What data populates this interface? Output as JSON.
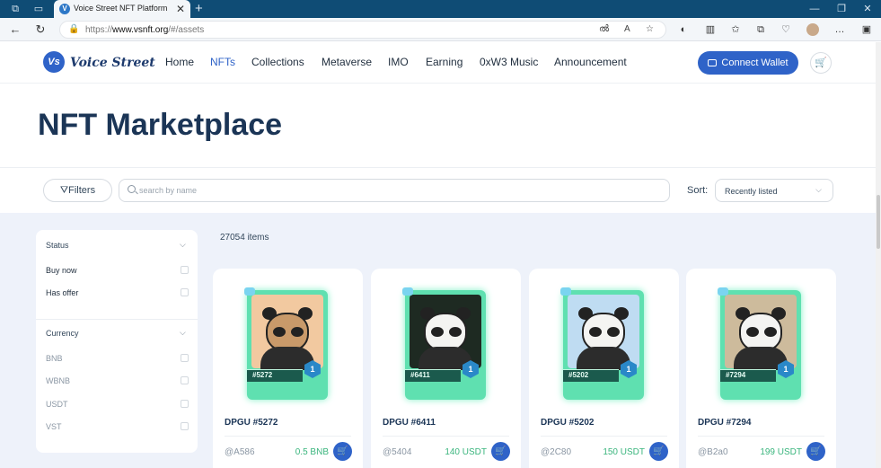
{
  "browser": {
    "tab_title": "Voice Street NFT Platform",
    "url_prefix": "https://",
    "url_host": "www.vsnft.org",
    "url_path": "/#/assets",
    "tab_close": "✕",
    "new_tab": "+"
  },
  "header": {
    "logo_mark": "Vs",
    "logo_text": "Voice Street",
    "nav": [
      "Home",
      "NFTs",
      "Collections",
      "Metaverse",
      "IMO",
      "Earning",
      "0xW3 Music",
      "Announcement"
    ],
    "active_nav": "NFTs",
    "connect_label": "Connect Wallet"
  },
  "hero": {
    "title": "NFT Marketplace"
  },
  "toolbar": {
    "filters_label": "Filters",
    "search_placeholder": "search by name",
    "search_value": "",
    "sort_label": "Sort:",
    "sort_value": "Recently listed"
  },
  "sidebar": {
    "status_title": "Status",
    "status_items": [
      "Buy now",
      "Has offer"
    ],
    "currency_title": "Currency",
    "currency_items": [
      "BNB",
      "WBNB",
      "USDT",
      "VST"
    ]
  },
  "results": {
    "count": "27054 items"
  },
  "cards": [
    {
      "title": "DPGU #5272",
      "tag": "#5272",
      "owner": "@A586",
      "price": "0.5 BNB",
      "rank": "1",
      "bg": "#f2c9a0",
      "fur": "#c99a6a"
    },
    {
      "title": "DPGU #6411",
      "tag": "#6411",
      "owner": "@5404",
      "price": "140 USDT",
      "rank": "1",
      "bg": "#1e2a22",
      "fur": "#f4f4f2"
    },
    {
      "title": "DPGU #5202",
      "tag": "#5202",
      "owner": "@2C80",
      "price": "150 USDT",
      "rank": "1",
      "bg": "#bfdcf2",
      "fur": "#f4f4f2"
    },
    {
      "title": "DPGU #7294",
      "tag": "#7294",
      "owner": "@B2a0",
      "price": "199 USDT",
      "rank": "1",
      "bg": "#cdbb9c",
      "fur": "#f4f4f2"
    }
  ],
  "colors": {
    "accent": "#2f63c8",
    "price": "#3ab57d",
    "title": "#1b3556",
    "main_bg": "#eef2fa"
  }
}
